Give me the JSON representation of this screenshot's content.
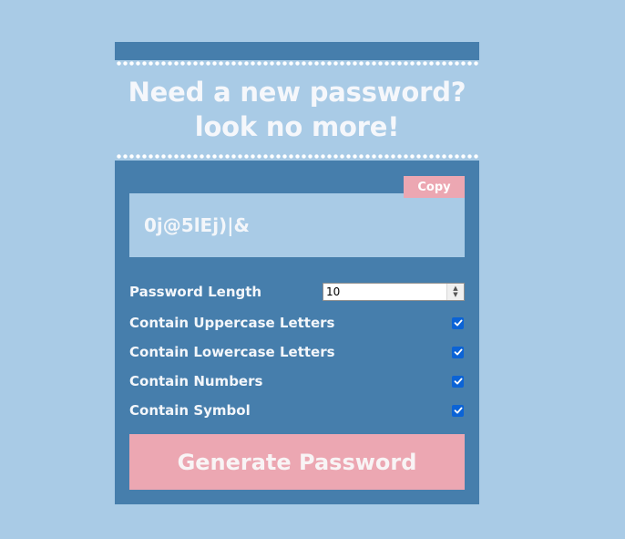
{
  "header": {
    "title_line1": "Need a new password?",
    "title_line2": "look no more!"
  },
  "generator": {
    "copy_label": "Copy",
    "password": "0j@5lEj)|&",
    "options": {
      "length_label": "Password Length",
      "length_value": "10",
      "uppercase_label": "Contain Uppercase Letters",
      "uppercase_checked": true,
      "lowercase_label": "Contain Lowercase Letters",
      "lowercase_checked": true,
      "numbers_label": "Contain Numbers",
      "numbers_checked": true,
      "symbol_label": "Contain Symbol",
      "symbol_checked": true
    },
    "generate_label": "Generate Password"
  },
  "colors": {
    "background": "#a9cbe6",
    "panel": "#467eac",
    "accent_pink": "#eca7b2",
    "checkbox_blue": "#0b63d6"
  },
  "icons": {
    "checkbox_mark": "check-icon",
    "spinner": "spinner-arrows-icon"
  }
}
